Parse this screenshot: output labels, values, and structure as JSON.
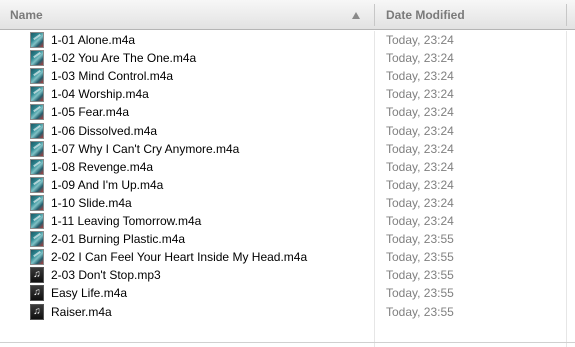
{
  "columns": {
    "name": "Name",
    "date_modified": "Date Modified"
  },
  "files": [
    {
      "name": "1-01 Alone.m4a",
      "date": "Today, 23:24",
      "icon": "album-art-icon"
    },
    {
      "name": "1-02 You Are The One.m4a",
      "date": "Today, 23:24",
      "icon": "album-art-icon"
    },
    {
      "name": "1-03 Mind Control.m4a",
      "date": "Today, 23:24",
      "icon": "album-art-icon"
    },
    {
      "name": "1-04 Worship.m4a",
      "date": "Today, 23:24",
      "icon": "album-art-icon"
    },
    {
      "name": "1-05 Fear.m4a",
      "date": "Today, 23:24",
      "icon": "album-art-icon"
    },
    {
      "name": "1-06 Dissolved.m4a",
      "date": "Today, 23:24",
      "icon": "album-art-icon"
    },
    {
      "name": "1-07 Why I Can't Cry Anymore.m4a",
      "date": "Today, 23:24",
      "icon": "album-art-icon"
    },
    {
      "name": "1-08 Revenge.m4a",
      "date": "Today, 23:24",
      "icon": "album-art-icon"
    },
    {
      "name": "1-09 And I'm Up.m4a",
      "date": "Today, 23:24",
      "icon": "album-art-icon"
    },
    {
      "name": "1-10 Slide.m4a",
      "date": "Today, 23:24",
      "icon": "album-art-icon"
    },
    {
      "name": "1-11 Leaving Tomorrow.m4a",
      "date": "Today, 23:24",
      "icon": "album-art-icon"
    },
    {
      "name": "2-01 Burning Plastic.m4a",
      "date": "Today, 23:55",
      "icon": "album-art-icon"
    },
    {
      "name": "2-02 I Can Feel Your Heart Inside My Head.m4a",
      "date": "Today, 23:55",
      "icon": "album-art-icon"
    },
    {
      "name": "2-03 Don't Stop.mp3",
      "date": "Today, 23:55",
      "icon": "music-note-icon"
    },
    {
      "name": "Easy Life.m4a",
      "date": "Today, 23:55",
      "icon": "music-note-icon"
    },
    {
      "name": "Raiser.m4a",
      "date": "Today, 23:55",
      "icon": "music-note-icon"
    }
  ]
}
